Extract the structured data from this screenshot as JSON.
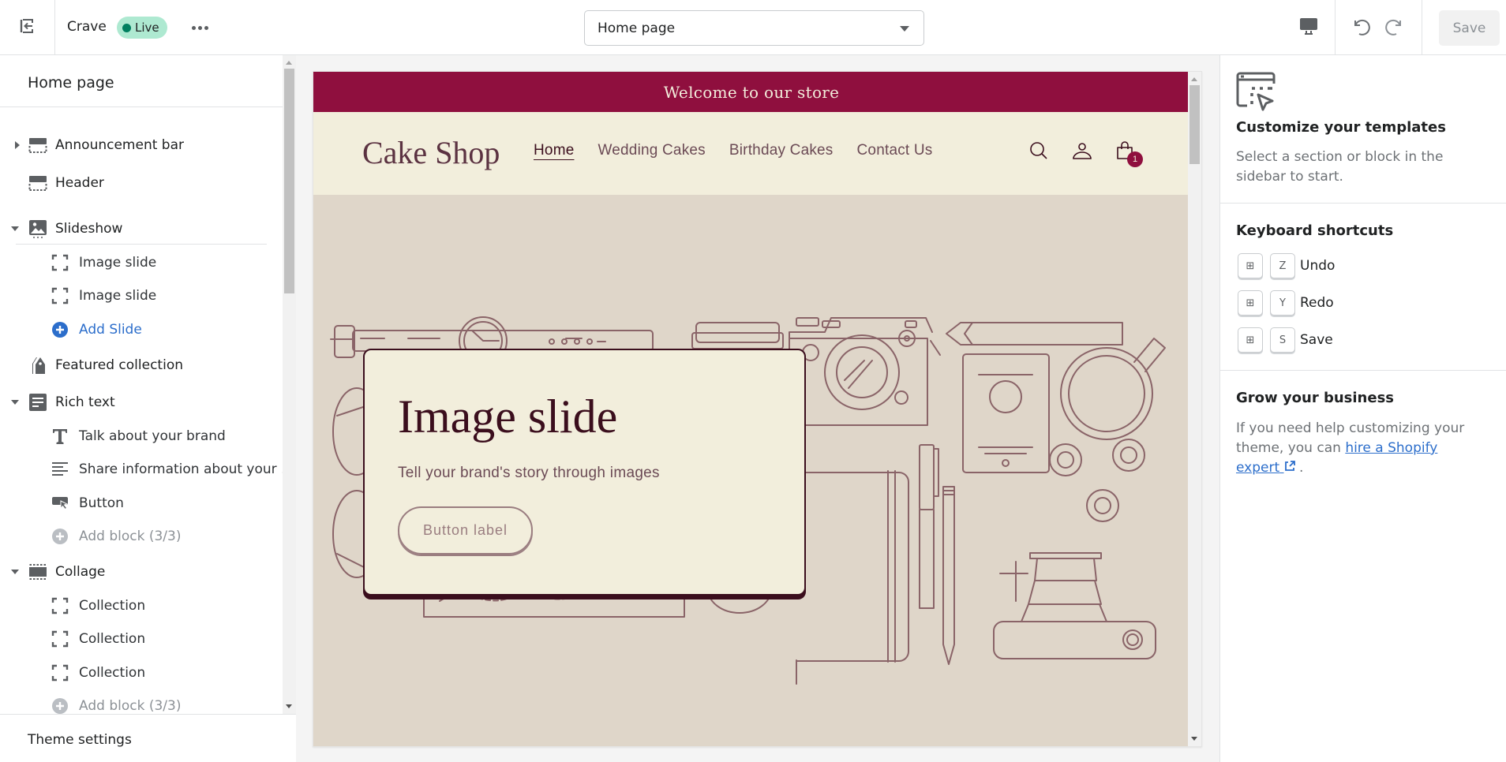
{
  "topbar": {
    "exit_icon": "exit-icon",
    "store_name": "Crave",
    "status_badge": "Live",
    "more_icon": "more-horizontal-icon",
    "page_select": {
      "selected": "Home page"
    },
    "device_icon": "desktop-icon",
    "undo_icon": "undo-icon",
    "redo_icon": "redo-icon",
    "save_label": "Save"
  },
  "sidebar": {
    "title": "Home page",
    "sections": [
      {
        "label": "Announcement bar",
        "icon": "section-header-icon",
        "toggle": "collapsed"
      },
      {
        "label": "Header",
        "icon": "section-header-icon",
        "toggle": "none"
      },
      {
        "label": "Slideshow",
        "icon": "image-section-icon",
        "toggle": "expanded",
        "children": [
          {
            "label": "Image slide",
            "icon": "block-icon"
          },
          {
            "label": "Image slide",
            "icon": "block-icon"
          },
          {
            "label": "Add Slide",
            "icon": "add-circle-icon",
            "type": "add"
          }
        ]
      },
      {
        "label": "Featured collection",
        "icon": "tag-icon",
        "toggle": "none"
      },
      {
        "label": "Rich text",
        "icon": "text-section-icon",
        "toggle": "expanded",
        "children": [
          {
            "label": "Talk about your brand",
            "icon": "heading-icon"
          },
          {
            "label": "Share information about your ...",
            "icon": "paragraph-icon"
          },
          {
            "label": "Button",
            "icon": "button-icon"
          },
          {
            "label": "Add block (3/3)",
            "icon": "add-circle-icon",
            "type": "add-disabled"
          }
        ]
      },
      {
        "label": "Collage",
        "icon": "section-header-icon",
        "toggle": "expanded",
        "children": [
          {
            "label": "Collection",
            "icon": "block-icon"
          },
          {
            "label": "Collection",
            "icon": "block-icon"
          },
          {
            "label": "Collection",
            "icon": "block-icon"
          },
          {
            "label": "Add block (3/3)",
            "icon": "add-circle-icon",
            "type": "add-disabled"
          }
        ]
      }
    ],
    "footer": "Theme settings"
  },
  "preview": {
    "announcement": "Welcome to our store",
    "logo": "Cake Shop",
    "nav": [
      "Home",
      "Wedding Cakes",
      "Birthday Cakes",
      "Contact Us"
    ],
    "active_nav": "Home",
    "cart_count": "1",
    "slide": {
      "title": "Image slide",
      "subtitle": "Tell your brand's story through images",
      "button": "Button label"
    },
    "colors": {
      "announcement_bg": "#8f0f3e",
      "header_bg": "#f2eedc",
      "slide_bg": "#dfd6c9",
      "text_dark": "#3b0e1d",
      "illustration_line": "#8a6468"
    }
  },
  "right_panel": {
    "customize": {
      "title": "Customize your templates",
      "text": "Select a section or block in the sidebar to start."
    },
    "shortcuts": {
      "title": "Keyboard shortcuts",
      "items": [
        {
          "modifier": "⊞",
          "key": "Z",
          "label": "Undo"
        },
        {
          "modifier": "⊞",
          "key": "Y",
          "label": "Redo"
        },
        {
          "modifier": "⊞",
          "key": "S",
          "label": "Save"
        }
      ]
    },
    "grow": {
      "title": "Grow your business",
      "text_before": "If you need help customizing your theme, you can ",
      "link": "hire a Shopify expert",
      "text_after": " ."
    }
  }
}
